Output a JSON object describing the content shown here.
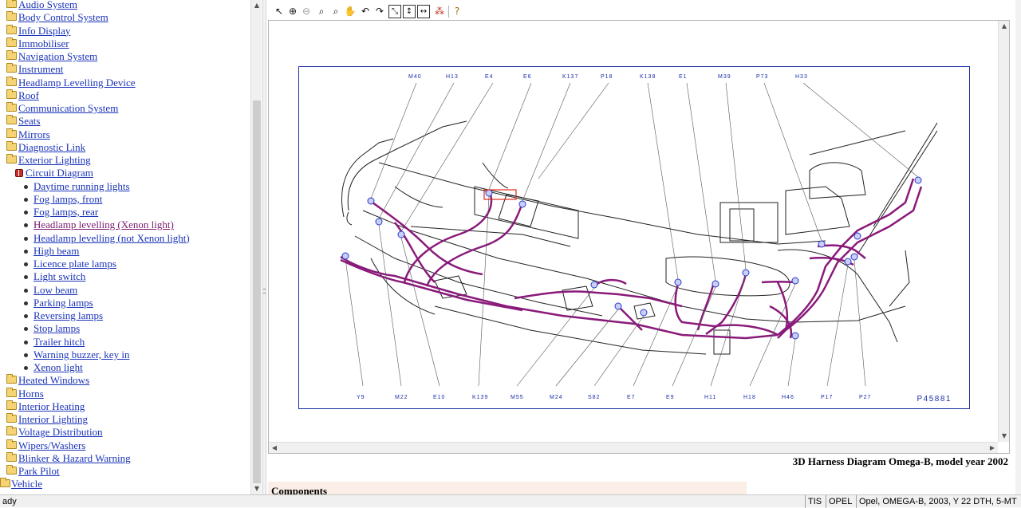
{
  "tree": {
    "items": [
      {
        "label": "Audio System",
        "type": "folder"
      },
      {
        "label": "Body Control System",
        "type": "folder"
      },
      {
        "label": "Info Display",
        "type": "folder"
      },
      {
        "label": "Immobiliser",
        "type": "folder"
      },
      {
        "label": "Navigation System",
        "type": "folder"
      },
      {
        "label": "Instrument",
        "type": "folder"
      },
      {
        "label": "Headlamp Levelling Device",
        "type": "folder"
      },
      {
        "label": "Roof",
        "type": "folder"
      },
      {
        "label": "Communication System",
        "type": "folder"
      },
      {
        "label": "Seats",
        "type": "folder"
      },
      {
        "label": "Mirrors",
        "type": "folder"
      },
      {
        "label": "Diagnostic Link",
        "type": "folder"
      },
      {
        "label": "Exterior Lighting",
        "type": "folder"
      },
      {
        "label": "Circuit Diagram",
        "type": "book"
      },
      {
        "label": "Daytime running lights",
        "type": "leaf"
      },
      {
        "label": "Fog lamps, front",
        "type": "leaf"
      },
      {
        "label": "Fog lamps, rear",
        "type": "leaf"
      },
      {
        "label": "Headlamp levelling (Xenon light)",
        "type": "leaf",
        "visited": true
      },
      {
        "label": "Headlamp levelling (not Xenon light)",
        "type": "leaf"
      },
      {
        "label": "High beam",
        "type": "leaf"
      },
      {
        "label": "Licence plate lamps",
        "type": "leaf"
      },
      {
        "label": "Light switch",
        "type": "leaf"
      },
      {
        "label": "Low beam",
        "type": "leaf"
      },
      {
        "label": "Parking lamps",
        "type": "leaf"
      },
      {
        "label": "Reversing lamps",
        "type": "leaf"
      },
      {
        "label": "Stop lamps",
        "type": "leaf"
      },
      {
        "label": "Trailer hitch",
        "type": "leaf"
      },
      {
        "label": "Warning buzzer, key in",
        "type": "leaf"
      },
      {
        "label": "Xenon light",
        "type": "leaf"
      },
      {
        "label": "Heated Windows",
        "type": "folder"
      },
      {
        "label": "Horns",
        "type": "folder"
      },
      {
        "label": "Interior Heating",
        "type": "folder"
      },
      {
        "label": "Interior Lighting",
        "type": "folder"
      },
      {
        "label": "Voltage Distribution",
        "type": "folder"
      },
      {
        "label": "Wipers/Washers",
        "type": "folder"
      },
      {
        "label": "Blinker & Hazard Warning",
        "type": "folder"
      },
      {
        "label": "Park Pilot",
        "type": "folder"
      },
      {
        "label": "Vehicle",
        "type": "folder",
        "level": 0
      }
    ]
  },
  "toolbar": {
    "buttons": [
      "select-arrow-icon",
      "zoom-in-icon",
      "zoom-out-icon",
      "zoom-icon",
      "zoom-area-icon",
      "pan-hand-icon",
      "rotate-left-icon",
      "rotate-right-icon",
      "fit-window-icon",
      "fit-height-icon",
      "fit-width-icon",
      "highlight-icon",
      "info-icon"
    ]
  },
  "diagram": {
    "top_labels": [
      "M40",
      "H13",
      "E4",
      "E6",
      "K137",
      "P18",
      "K138",
      "E1",
      "M39",
      "P73",
      "H33"
    ],
    "bottom_labels": [
      "Y9",
      "M22",
      "E10",
      "K139",
      "M55",
      "M24",
      "S82",
      "E7",
      "E9",
      "H11",
      "H18",
      "H46",
      "P17",
      "P27"
    ],
    "ref": "P45881",
    "wire_color": "#8a1a7a",
    "connector_color": "#2a3ad0",
    "label_color": "#1c2ea8"
  },
  "caption": "3D Harness Diagram Omega-B, model year 2002",
  "components_heading": "Components",
  "status": {
    "left": "ady",
    "tis": "TIS",
    "opel": "OPEL",
    "vehicle": "Opel, OMEGA-B, 2003, Y 22 DTH, 5-MT"
  }
}
